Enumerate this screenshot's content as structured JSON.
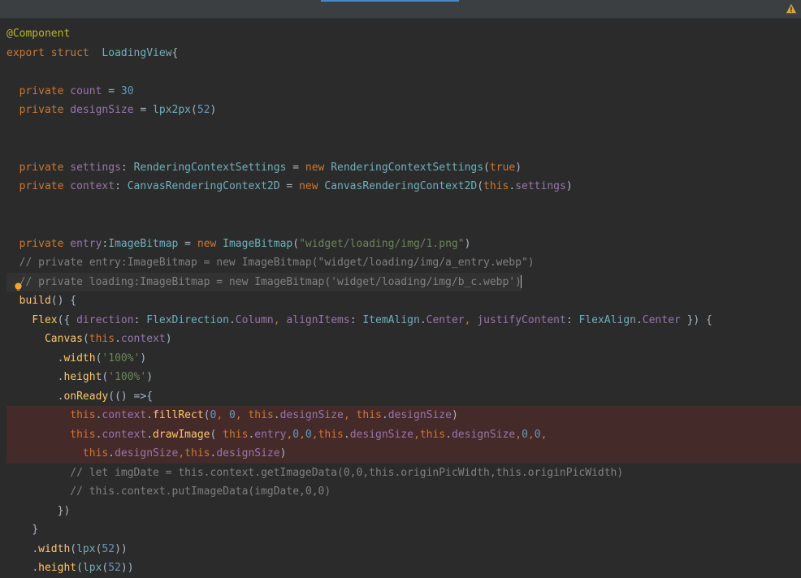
{
  "decorator": "@Component",
  "kw_export": "export",
  "kw_struct": "struct",
  "class_name": "LoadingView",
  "brace_open": "{",
  "kw_private": "private",
  "kw_new": "new",
  "kw_true": "true",
  "kw_this": "this",
  "field_count": "count",
  "field_designSize": "designSize",
  "field_settings": "settings",
  "field_context": "context",
  "field_entry": "entry",
  "val_30": "30",
  "val_52": "52",
  "val_0": "0",
  "fn_lpx2px": "lpx2px",
  "fn_lpx": "lpx",
  "type_RCS": "RenderingContextSettings",
  "type_CRC2D": "CanvasRenderingContext2D",
  "type_ImageBitmap": "ImageBitmap",
  "str_path1": "\"widget/loading/img/1.png\"",
  "comment_a": "// private entry:ImageBitmap = new ImageBitmap(\"widget/loading/img/a_entry.webp\")",
  "comment_b": "// private loading:ImageBitmap = new ImageBitmap('widget/loading/img/b_c.webp')",
  "fn_build": "build",
  "fn_Flex": "Flex",
  "id_direction": "direction",
  "id_FlexDirection": "FlexDirection",
  "id_Column": "Column",
  "id_alignItems": "alignItems",
  "id_ItemAlign": "ItemAlign",
  "id_Center": "Center",
  "id_justifyContent": "justifyContent",
  "id_FlexAlign": "FlexAlign",
  "fn_Canvas": "Canvas",
  "fn_width": "width",
  "fn_height": "height",
  "fn_onReady": "onReady",
  "fn_fillRect": "fillRect",
  "fn_drawImage": "drawImage",
  "str_100": "'100%'",
  "comment_c": "// let imgDate = this.context.getImageData(0,0,this.originPicWidth,this.originPicWidth)",
  "comment_d": "// this.context.putImageData(imgDate,0,0)",
  "icons": {
    "warn": "warning-triangle",
    "bulb": "lightbulb"
  }
}
